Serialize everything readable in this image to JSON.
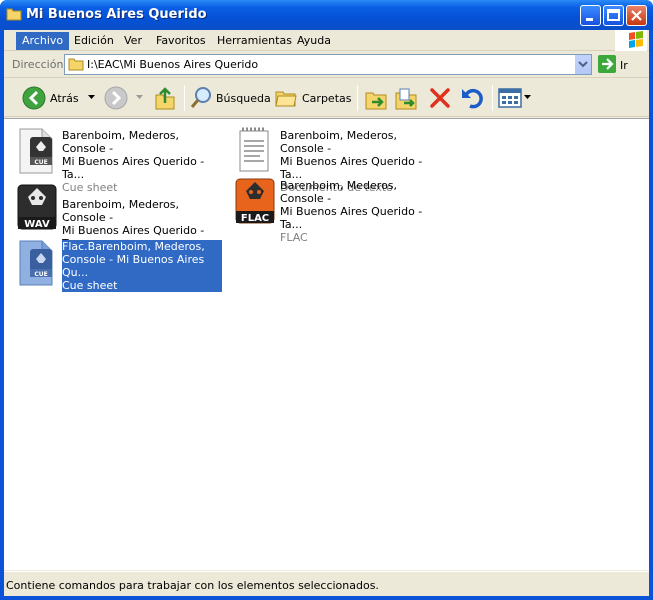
{
  "window": {
    "title": "Mi Buenos Aires Querido"
  },
  "menubar": {
    "items": [
      {
        "label": "Archivo",
        "active": true
      },
      {
        "label": "Edición"
      },
      {
        "label": "Ver"
      },
      {
        "label": "Favoritos"
      },
      {
        "label": "Herramientas"
      },
      {
        "label": "Ayuda"
      }
    ]
  },
  "address": {
    "label": "Dirección",
    "path": "I:\\EAC\\Mi Buenos Aires Querido",
    "go_label": "Ir"
  },
  "toolbar": {
    "back_label": "Atrás",
    "search_label": "Búsqueda",
    "folders_label": "Carpetas"
  },
  "files": [
    {
      "name_line1": "Barenboim, Mederos, Console -",
      "name_line2": "Mi Buenos Aires Querido - Ta...",
      "type": "Cue sheet",
      "icon": "cue-sheet-icon"
    },
    {
      "name_line1": "Barenboim, Mederos, Console -",
      "name_line2": "Mi Buenos Aires Querido - Ta...",
      "type": "Documento de texto",
      "icon": "text-document-icon"
    },
    {
      "name_line1": "Barenboim, Mederos, Console -",
      "name_line2": "Mi Buenos Aires Querido - Ta...",
      "type": "",
      "icon": "wav-file-icon"
    },
    {
      "name_line1": "Barenboim, Mederos, Console -",
      "name_line2": "Mi Buenos Aires Querido - Ta...",
      "type": "FLAC",
      "icon": "flac-file-icon"
    },
    {
      "name_line1": "Flac.Barenboim, Mederos,",
      "name_line2": "Console - Mi Buenos Aires Qu...",
      "type": "Cue sheet",
      "icon": "cue-sheet-icon",
      "selected": true
    }
  ],
  "status": {
    "text": "Contiene comandos para trabajar con los elementos seleccionados."
  },
  "colors": {
    "title_blue": "#0a5fe4",
    "selection": "#316ac5",
    "chrome": "#ece9d8"
  }
}
